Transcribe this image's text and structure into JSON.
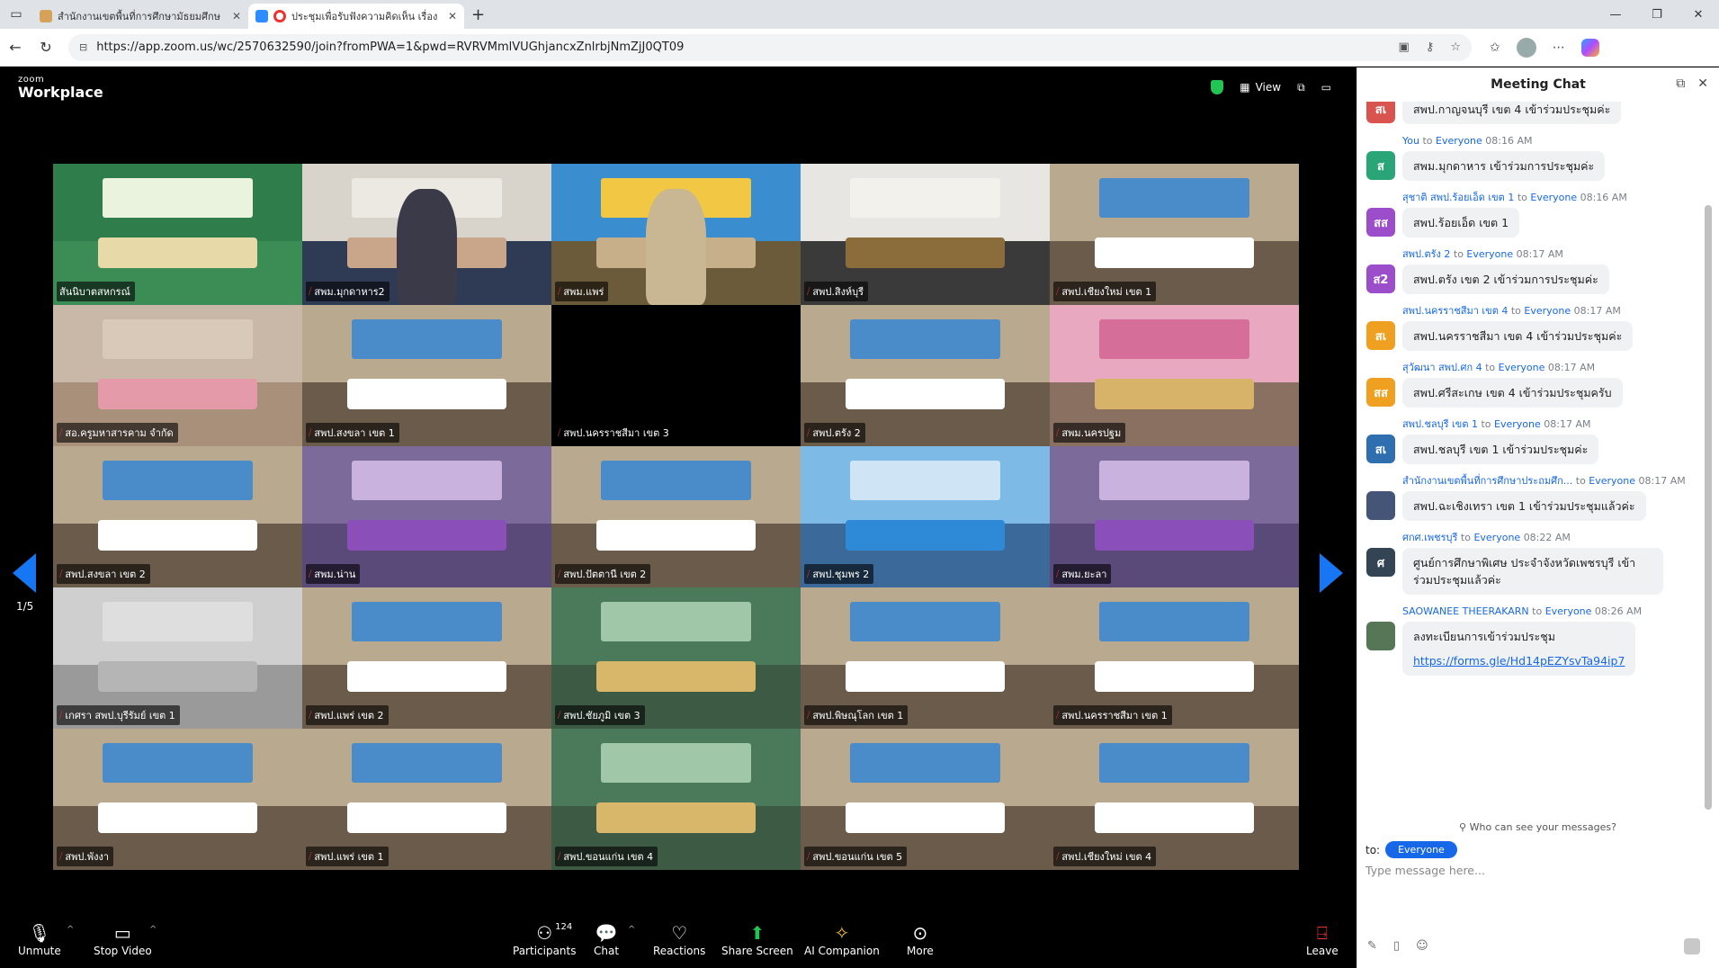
{
  "browser": {
    "tabs": [
      {
        "title": "สำนักงานเขตพื้นที่การศึกษามัธยมศึกษ",
        "active": false
      },
      {
        "title": "ประชุมเพื่อรับฟังความคิดเห็น เรื่อง",
        "active": true
      }
    ],
    "url": "https://app.zoom.us/wc/2570632590/join?fromPWA=1&pwd=RVRVMmlVUGhjancxZnlrbjNmZjJ0QT09"
  },
  "zoom": {
    "brand_small": "zoom",
    "brand_large": "Workplace",
    "view_label": "View",
    "page_indicator": "1/5",
    "participants": [
      {
        "name": "สันนิบาตสหกรณ์",
        "muted": false,
        "scene": "banner",
        "active": true
      },
      {
        "name": "สพม.มุกดาหาร2",
        "muted": true,
        "scene": "person"
      },
      {
        "name": "สพม.แพร่",
        "muted": true,
        "scene": "person2"
      },
      {
        "name": "สพป.สิงห์บุรี",
        "muted": true,
        "scene": "office"
      },
      {
        "name": "สพป.เชียงใหม่ เขต 1",
        "muted": true,
        "scene": "room"
      },
      {
        "name": "สอ.ครูมหาสารคาม จำกัด",
        "muted": true,
        "scene": "hall"
      },
      {
        "name": "สพป.สงขลา เขต 1",
        "muted": true,
        "scene": "room"
      },
      {
        "name": "สพป.นครราชสีมา เขต 3",
        "muted": true,
        "scene": "black"
      },
      {
        "name": "สพป.ตรัง 2",
        "muted": true,
        "scene": "room"
      },
      {
        "name": "สพม.นครปฐม",
        "muted": true,
        "scene": "pink"
      },
      {
        "name": "สพป.สงขลา เขต 2",
        "muted": true,
        "scene": "room"
      },
      {
        "name": "สพม.น่าน",
        "muted": true,
        "scene": "purple"
      },
      {
        "name": "สพป.ปัตตานี เขต 2",
        "muted": true,
        "scene": "room"
      },
      {
        "name": "สพป.ชุมพร 2",
        "muted": true,
        "scene": "blue"
      },
      {
        "name": "สพม.ยะลา",
        "muted": true,
        "scene": "purple"
      },
      {
        "name": "เกศรา สพป.บุรีรัมย์ เขต 1",
        "muted": true,
        "scene": "blur"
      },
      {
        "name": "สพป.แพร่ เขต 2",
        "muted": true,
        "scene": "room"
      },
      {
        "name": "สพป.ชัยภูมิ เขต 3",
        "muted": true,
        "scene": "forest"
      },
      {
        "name": "สพป.พิษณุโลก เขต 1",
        "muted": true,
        "scene": "room"
      },
      {
        "name": "สพป.นครราชสีมา เขต 1",
        "muted": true,
        "scene": "room"
      },
      {
        "name": "สพป.พังงา",
        "muted": true,
        "scene": "room"
      },
      {
        "name": "สพป.แพร่ เขต 1",
        "muted": true,
        "scene": "room"
      },
      {
        "name": "สพป.ขอนแก่น เขต 4",
        "muted": true,
        "scene": "forest"
      },
      {
        "name": "สพป.ขอนแก่น เขต 5",
        "muted": true,
        "scene": "room"
      },
      {
        "name": "สพป.เชียงใหม่ เขต 4",
        "muted": true,
        "scene": "room"
      }
    ],
    "toolbar": {
      "unmute": "Unmute",
      "stop_video": "Stop Video",
      "participants": "Participants",
      "participants_count": "124",
      "chat": "Chat",
      "reactions": "Reactions",
      "share_screen": "Share Screen",
      "ai_companion": "AI Companion",
      "more": "More",
      "leave": "Leave"
    }
  },
  "chat": {
    "title": "Meeting Chat",
    "messages": [
      {
        "sender": "",
        "time": "",
        "avatar": "สเ",
        "color": "#d9534f",
        "text": "สพป.กาญจนบุรี เขต 4 เข้าร่วมประชุมค่ะ"
      },
      {
        "sender": "You",
        "time": "08:16 AM",
        "avatar": "ส",
        "color": "#2aa578",
        "text": "สพม.มุกดาหาร เข้าร่วมการประชุมค่ะ"
      },
      {
        "sender": "สุชาติ สพป.ร้อยเอ็ด เขต 1",
        "time": "08:16 AM",
        "avatar": "สส",
        "color": "#9b4dca",
        "text": "สพป.ร้อยเอ็ด เขต 1"
      },
      {
        "sender": "สพป.ตรัง 2",
        "time": "08:17 AM",
        "avatar": "ส2",
        "color": "#9b4dca",
        "text": "สพป.ตรัง เขต 2 เข้าร่วมการประชุมค่ะ"
      },
      {
        "sender": "สพป.นครราชสีมา เขต 4",
        "time": "08:17 AM",
        "avatar": "สเ",
        "color": "#f0a020",
        "text": "สพป.นครราชสีมา เขต 4 เข้าร่วมประชุมค่ะ"
      },
      {
        "sender": "สุวัฒนา สพป.ศก 4",
        "time": "08:17 AM",
        "avatar": "สส",
        "color": "#f0a020",
        "text": "สพป.ศรีสะเกษ เขต 4 เข้าร่วมประชุมครับ"
      },
      {
        "sender": "สพป.ชลบุรี เขต 1",
        "time": "08:17 AM",
        "avatar": "สเ",
        "color": "#2f6fb0",
        "text": "สพป.ชลบุรี เขต 1 เข้าร่วมประชุมค่ะ"
      },
      {
        "sender": "สำนักงานเขตพื้นที่การศึกษาประถมศึก...",
        "time": "08:17 AM",
        "avatar": "",
        "color": "#445577",
        "text": "สพป.ฉะเชิงเทรา เขต 1 เข้าร่วมประชุมแล้วค่ะ"
      },
      {
        "sender": "ศกศ.เพชรบุรี",
        "time": "08:22 AM",
        "avatar": "ศ",
        "color": "#334455",
        "text": "ศูนย์การศึกษาพิเศษ ประจำจังหวัดเพชรบุรี เข้าร่วมประชุมแล้วค่ะ"
      },
      {
        "sender": "SAOWANEE THEERAKARN",
        "time": "08:26 AM",
        "avatar": "",
        "color": "#557755",
        "text": "ลงทะเบียนการเข้าร่วมประชุม",
        "link": "https://forms.gle/Hd14pEZYsvTa94ip7"
      }
    ],
    "to_word": "to",
    "everyone": "Everyone",
    "who_can_see": "Who can see your messages?",
    "to_label": "to:",
    "to_target": "Everyone",
    "input_placeholder": "Type message here..."
  }
}
